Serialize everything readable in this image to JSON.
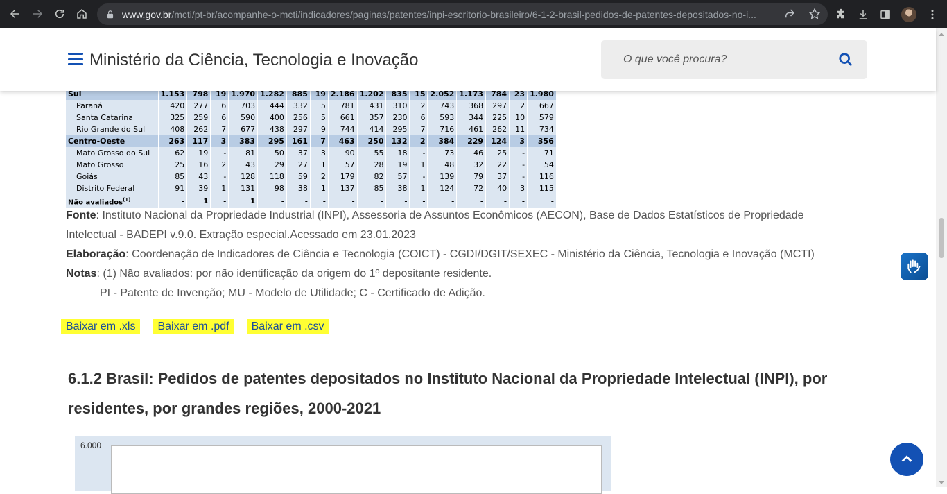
{
  "browser": {
    "url_domain": "www.gov.br",
    "url_path": "/mcti/pt-br/acompanhe-o-mcti/indicadores/paginas/patentes/inpi-escritorio-brasileiro/6-1-2-brasil-pedidos-de-patentes-depositados-no-i..."
  },
  "header": {
    "site_title": "Ministério da Ciência, Tecnologia e Inovação",
    "search_placeholder": "O que você procura?"
  },
  "table": {
    "rows": [
      {
        "type": "region",
        "name": "Sul",
        "values": [
          "1.153",
          "798",
          "19",
          "1.970",
          "1.282",
          "885",
          "19",
          "2.186",
          "1.202",
          "835",
          "15",
          "2.052",
          "1.173",
          "784",
          "23",
          "1.980"
        ]
      },
      {
        "type": "state",
        "name": "Paraná",
        "values": [
          "420",
          "277",
          "6",
          "703",
          "444",
          "332",
          "5",
          "781",
          "431",
          "310",
          "2",
          "743",
          "368",
          "297",
          "2",
          "667"
        ]
      },
      {
        "type": "state",
        "name": "Santa Catarina",
        "values": [
          "325",
          "259",
          "6",
          "590",
          "400",
          "256",
          "5",
          "661",
          "357",
          "230",
          "6",
          "593",
          "344",
          "225",
          "10",
          "579"
        ]
      },
      {
        "type": "state",
        "name": "Rio Grande do Sul",
        "values": [
          "408",
          "262",
          "7",
          "677",
          "438",
          "297",
          "9",
          "744",
          "414",
          "295",
          "7",
          "716",
          "461",
          "262",
          "11",
          "734"
        ]
      },
      {
        "type": "region",
        "name": "Centro-Oeste",
        "values": [
          "263",
          "117",
          "3",
          "383",
          "295",
          "161",
          "7",
          "463",
          "250",
          "132",
          "2",
          "384",
          "229",
          "124",
          "3",
          "356"
        ]
      },
      {
        "type": "state",
        "name": "Mato Grosso do Sul",
        "values": [
          "62",
          "19",
          "-",
          "81",
          "50",
          "37",
          "3",
          "90",
          "55",
          "18",
          "-",
          "73",
          "46",
          "25",
          "-",
          "71"
        ]
      },
      {
        "type": "state",
        "name": "Mato Grosso",
        "values": [
          "25",
          "16",
          "2",
          "43",
          "29",
          "27",
          "1",
          "57",
          "28",
          "19",
          "1",
          "48",
          "32",
          "22",
          "-",
          "54"
        ]
      },
      {
        "type": "state",
        "name": "Goiás",
        "values": [
          "85",
          "43",
          "-",
          "128",
          "118",
          "59",
          "2",
          "179",
          "82",
          "57",
          "-",
          "139",
          "79",
          "37",
          "-",
          "116"
        ]
      },
      {
        "type": "state",
        "name": "Distrito Federal",
        "values": [
          "91",
          "39",
          "1",
          "131",
          "98",
          "38",
          "1",
          "137",
          "85",
          "38",
          "1",
          "124",
          "72",
          "40",
          "3",
          "115"
        ]
      },
      {
        "type": "na",
        "name": "Não avaliados",
        "sup": "(1)",
        "values": [
          "-",
          "1",
          "-",
          "1",
          "-",
          "-",
          "-",
          "-",
          "-",
          "-",
          "-",
          "-",
          "-",
          "-",
          "-",
          "-"
        ]
      }
    ]
  },
  "notes": {
    "fonte_label": "Fonte",
    "fonte_text": ": Instituto Nacional da Propriedade Industrial (INPI), Assessoria de Assuntos Econômicos (AECON), Base de Dados Estatísticos de Propriedade Intelectual - BADEPI v.9.0. Extração especial.Acessado em 23.01.2023",
    "elaboracao_label": "Elaboração",
    "elaboracao_text": ": Coordenação de Indicadores de Ciência e Tecnologia (COICT) - CGDI/DGIT/SEXEC - Ministério da Ciência, Tecnologia e Inovação (MCTI)",
    "notas_label": "Notas",
    "notas_text1": ": (1) Não avaliados: por não identificação da origem do 1º depositante residente.",
    "notas_text2": "PI - Patente de Invenção; MU - Modelo de Utilidade; C - Certificado de Adição."
  },
  "downloads": [
    "Baixar em .xls",
    "Baixar em .pdf",
    "Baixar em .csv"
  ],
  "section_title": "6.1.2 Brasil: Pedidos de patentes depositados no Instituto Nacional da Propriedade Intelectual (INPI), por residentes, por grandes regiões, 2000-2021",
  "chart": {
    "y_tick_top": "6.000"
  },
  "colors": {
    "brand_blue": "#1351b4",
    "highlight": "#ffff33",
    "table_region": "#b8cce4",
    "table_state": "#dce6f1"
  }
}
